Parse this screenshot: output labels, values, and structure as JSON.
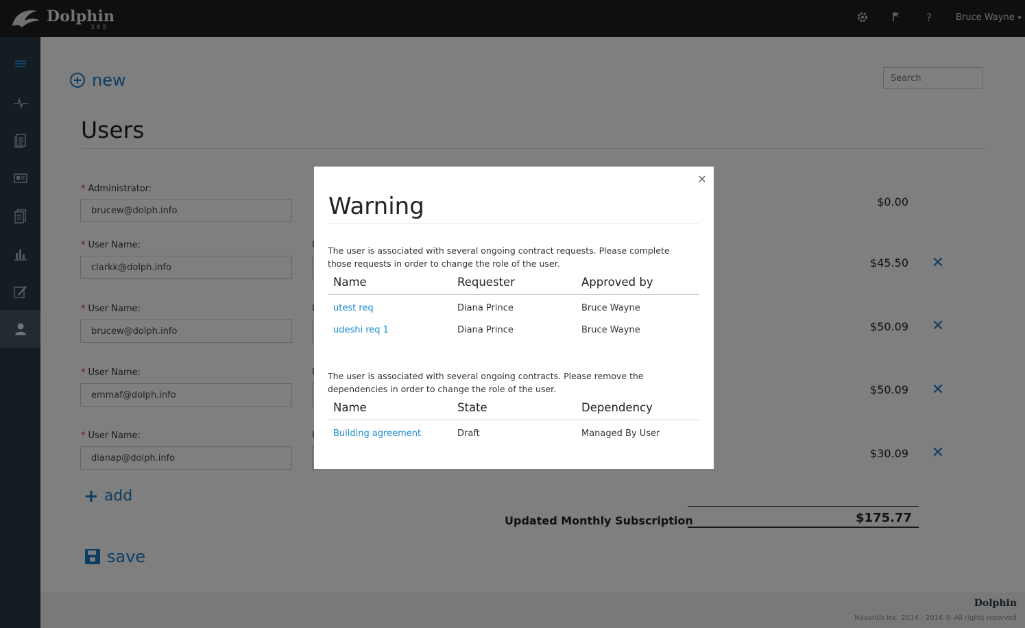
{
  "topbar": {
    "brand": "Dolphin",
    "brand_sub": "365",
    "icons": [
      "gear-icon",
      "flag-icon",
      "help-icon"
    ],
    "help_glyph": "?",
    "user_name": "Bruce Wayne"
  },
  "sidebar": {
    "items": [
      {
        "name": "menu-icon"
      },
      {
        "name": "activity-icon"
      },
      {
        "name": "document-icon"
      },
      {
        "name": "id-card-icon"
      },
      {
        "name": "documents-icon"
      },
      {
        "name": "bar-chart-icon"
      },
      {
        "name": "edit-icon"
      },
      {
        "name": "user-icon",
        "active": true
      }
    ]
  },
  "main": {
    "new_label": "new",
    "search_placeholder": "Search",
    "title": "Users",
    "admin_label": "Administrator:",
    "username_label": "User Name:",
    "admin_value": "brucew@dolph.info",
    "admin_amount": "$0.00",
    "users": [
      {
        "email": "clarkk@dolph.info",
        "amount": "$45.50"
      },
      {
        "email": "brucew@dolph.info",
        "amount": "$50.09"
      },
      {
        "email": "emmaf@dolph.info",
        "amount": "$50.09"
      },
      {
        "email": "dianap@dolph.info",
        "amount": "$30.09"
      }
    ],
    "stub_label": "U",
    "remove_glyph": "✕",
    "add_label": "add",
    "subscription_label": "Updated Monthly Subscription",
    "subscription_total": "$175.77",
    "save_label": "save"
  },
  "footer": {
    "brand": "Dolphin",
    "copyright": "Navantis Inc. 2014 - 2016 © All rights reserved"
  },
  "modal": {
    "close_glyph": "×",
    "title": "Warning",
    "message1": "The user is associated with several ongoing contract requests. Please complete those requests in order to change the role of the user.",
    "table1": {
      "headers": [
        "Name",
        "Requester",
        "Approved by"
      ],
      "rows": [
        {
          "name": "utest req",
          "requester": "Diana Prince",
          "approved_by": "Bruce Wayne"
        },
        {
          "name": "udeshi req 1",
          "requester": "Diana Prince",
          "approved_by": "Bruce Wayne"
        }
      ]
    },
    "message2": "The user is associated with several ongoing contracts. Please remove the dependencies in order to change the role of the user.",
    "table2": {
      "headers": [
        "Name",
        "State",
        "Dependency"
      ],
      "rows": [
        {
          "name": "Building agreement",
          "state": "Draft",
          "dependency": "Managed By User"
        }
      ]
    }
  }
}
